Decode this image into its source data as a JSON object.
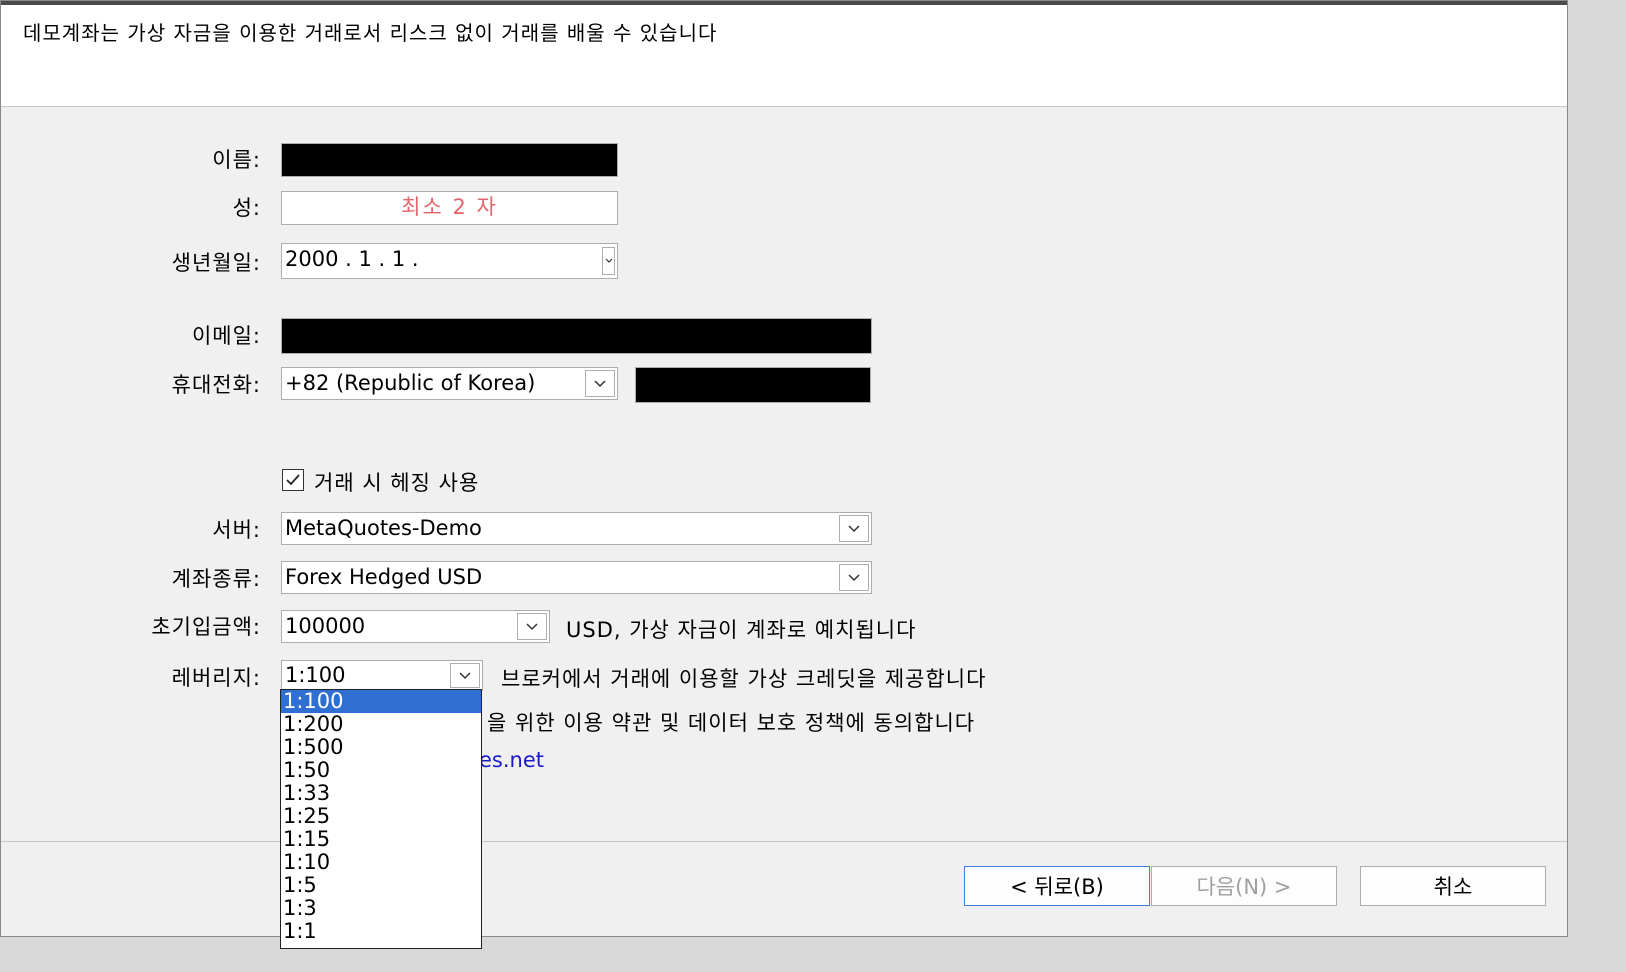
{
  "header": {
    "text": "데모계좌는 가상 자금을 이용한 거래로서 리스크 없이 거래를 배울 수 있습니다"
  },
  "form": {
    "first_name": {
      "label": "이름:"
    },
    "last_name": {
      "label": "성:",
      "placeholder": "최소 2 자"
    },
    "birth_date": {
      "label": "생년월일:",
      "value": "2000 .  1 .  1 ."
    },
    "email": {
      "label": "이메일:"
    },
    "phone": {
      "label": "휴대전화:",
      "country": "+82 (Republic of Korea)"
    },
    "hedging": {
      "label": "거래 시 헤징 사용",
      "checked": true
    },
    "server": {
      "label": "서버:",
      "value": "MetaQuotes-Demo"
    },
    "account_type": {
      "label": "계좌종류:",
      "value": "Forex Hedged USD"
    },
    "deposit": {
      "label": "초기입금액:",
      "value": "100000",
      "note": "USD, 가상 자금이 계좌로 예치됩니다"
    },
    "leverage": {
      "label": "레버리지:",
      "value": "1:100",
      "note": "브로커에서 거래에 이용할 가상 크레딧을 제공합니다",
      "options": [
        "1:100",
        "1:200",
        "1:500",
        "1:50",
        "1:33",
        "1:25",
        "1:15",
        "1:10",
        "1:5",
        "1:3",
        "1:1"
      ]
    },
    "agreement_partial": "을 위한 이용 약관 및 데이터 보호 정책에 동의합니다",
    "link_partial": "es.net"
  },
  "buttons": {
    "back": "< 뒤로(B)",
    "next": "다음(N) >",
    "cancel": "취소"
  },
  "colors": {
    "accent": "#2f6fd1",
    "placeholder": "#e0666b",
    "link": "#1a1acc"
  }
}
